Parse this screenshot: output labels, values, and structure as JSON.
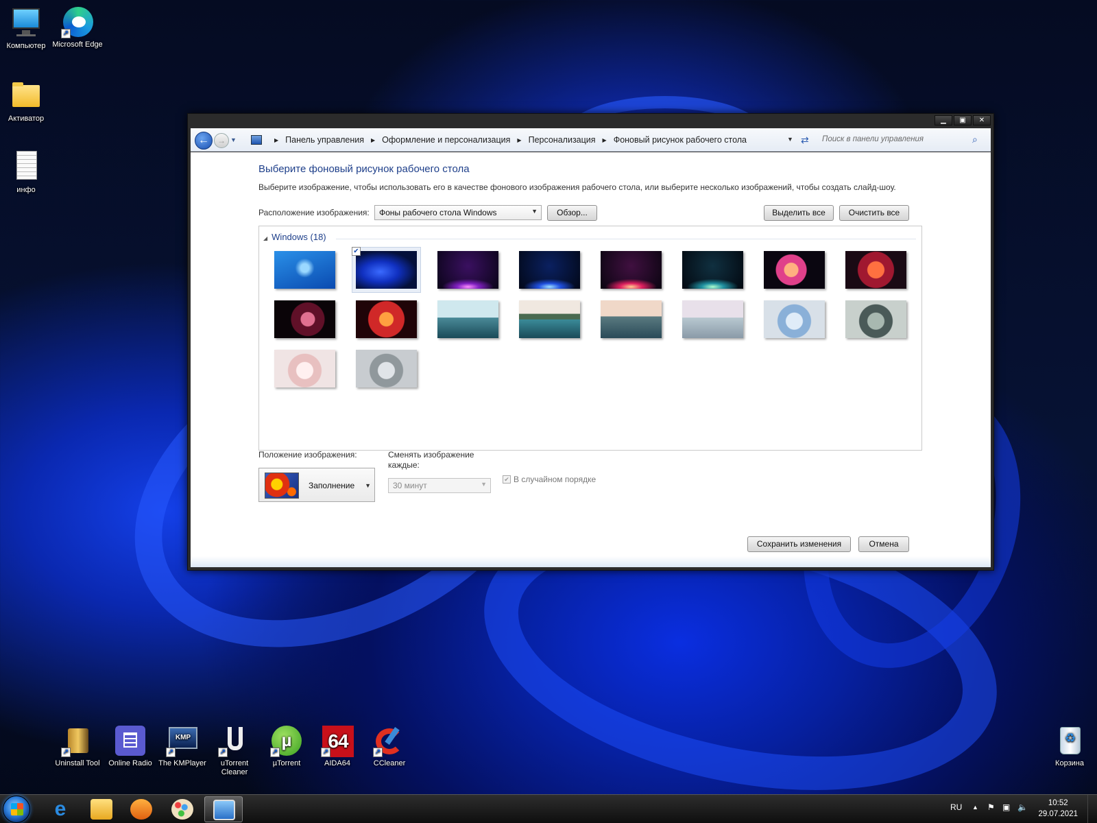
{
  "desktop": {
    "icons_top": [
      {
        "label": "Компьютер",
        "icon": "computer-icon"
      },
      {
        "label": "Microsoft Edge",
        "icon": "edge-icon"
      },
      {
        "label": "Активатор",
        "icon": "folder-icon"
      },
      {
        "label": "инфо",
        "icon": "text-file-icon"
      }
    ],
    "icons_bottom": [
      {
        "label": "Uninstall Tool",
        "icon": "uninstall-tool-icon"
      },
      {
        "label": "Online Radio",
        "icon": "online-radio-icon"
      },
      {
        "label": "The KMPlayer",
        "icon": "kmplayer-icon"
      },
      {
        "label": "uTorrent Cleaner",
        "icon": "utorrent-cleaner-icon"
      },
      {
        "label": "µTorrent",
        "icon": "utorrent-icon"
      },
      {
        "label": "AIDA64",
        "icon": "aida64-icon"
      },
      {
        "label": "CCleaner",
        "icon": "ccleaner-icon"
      }
    ],
    "recycle_bin": "Корзина"
  },
  "window": {
    "breadcrumbs": [
      "Панель управления",
      "Оформление и персонализация",
      "Персонализация",
      "Фоновый рисунок рабочего стола"
    ],
    "search_placeholder": "Поиск в панели управления",
    "heading": "Выберите фоновый рисунок рабочего стола",
    "description": "Выберите изображение, чтобы использовать его в качестве фонового изображения рабочего стола, или выберите несколько изображений, чтобы создать слайд-шоу.",
    "location_label": "Расположение изображения:",
    "location_value": "Фоны рабочего стола Windows",
    "browse_button": "Обзор...",
    "select_all_button": "Выделить все",
    "clear_all_button": "Очистить все",
    "group_label": "Windows (18)",
    "thumbnails": [
      {
        "theme": "win7-blue",
        "selected": false
      },
      {
        "theme": "win11-bloom-dark",
        "selected": true
      },
      {
        "theme": "glow-purple",
        "selected": false
      },
      {
        "theme": "glow-blue",
        "selected": false
      },
      {
        "theme": "glow-red",
        "selected": false
      },
      {
        "theme": "glow-green",
        "selected": false
      },
      {
        "theme": "flower-pink",
        "selected": false
      },
      {
        "theme": "flower-red",
        "selected": false
      },
      {
        "theme": "swirl-dark-red",
        "selected": false
      },
      {
        "theme": "swirl-orange",
        "selected": false
      },
      {
        "theme": "lake-teal",
        "selected": false
      },
      {
        "theme": "lake-forest",
        "selected": false
      },
      {
        "theme": "lake-dusk",
        "selected": false
      },
      {
        "theme": "lake-pale",
        "selected": false
      },
      {
        "theme": "bloom-blue",
        "selected": false
      },
      {
        "theme": "bloom-grey",
        "selected": false
      },
      {
        "theme": "bloom-pink",
        "selected": false
      },
      {
        "theme": "bloom-silver",
        "selected": false
      }
    ],
    "position_label": "Положение изображения:",
    "position_value": "Заполнение",
    "interval_label": "Сменять изображение каждые:",
    "interval_value": "30 минут",
    "shuffle_label": "В случайном порядке",
    "shuffle_checked": true,
    "save_button": "Сохранить изменения",
    "cancel_button": "Отмена"
  },
  "taskbar": {
    "language": "RU",
    "time": "10:52",
    "date": "29.07.2021",
    "pinned": [
      "ie-icon",
      "explorer-icon",
      "media-player-icon",
      "paint-icon",
      "personalization-icon"
    ]
  }
}
